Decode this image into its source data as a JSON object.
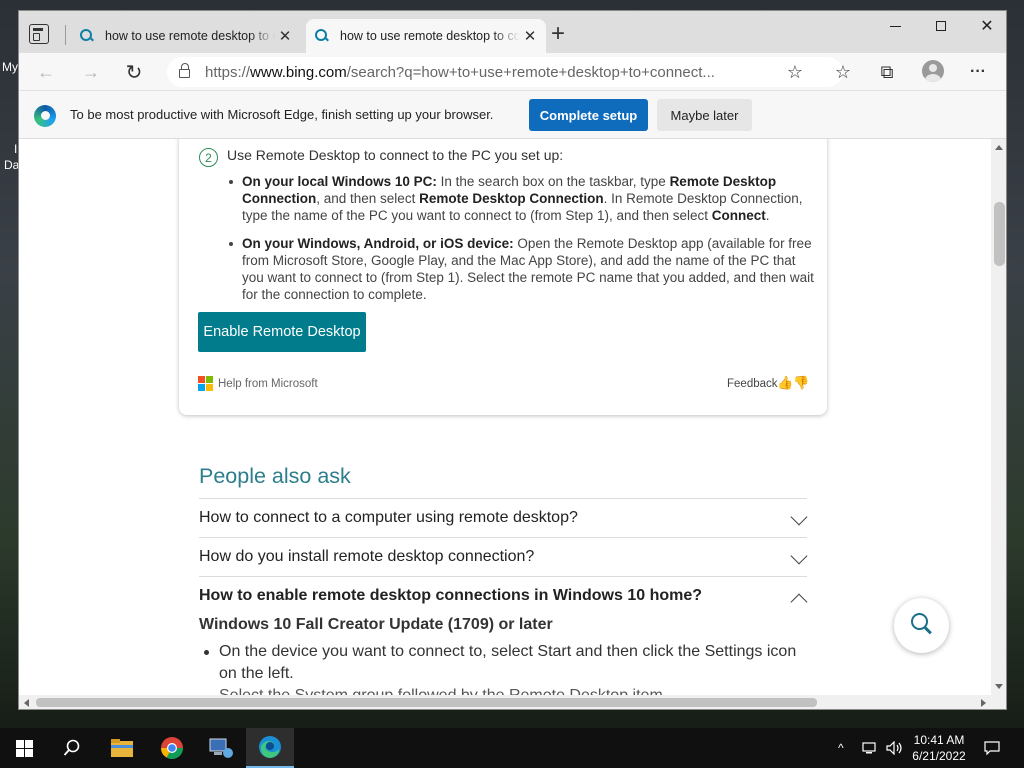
{
  "desktop": {
    "labels": [
      "My",
      "I",
      "Da"
    ]
  },
  "browser": {
    "tabs": [
      {
        "title": "how to use remote desktop to connect to a pc"
      },
      {
        "title": "how to use remote desktop to connect to a pc"
      }
    ],
    "new_tab": "+",
    "address": {
      "scheme": "https://",
      "host": "www.bing.com",
      "path": "/search?q=how+to+use+remote+desktop+to+connect..."
    },
    "icons": {
      "back": "←",
      "forward": "→",
      "refresh": "↻",
      "favorite_add": "☆",
      "favorites": "☆",
      "collections": "⧉",
      "menu": "···"
    }
  },
  "infobar": {
    "message": "To be most productive with Microsoft Edge, finish setting up your browser.",
    "primary_label": "Complete setup",
    "secondary_label": "Maybe later"
  },
  "card": {
    "step_number": "2",
    "step_text": "Use Remote Desktop to connect to the PC you set up:",
    "bullet1": {
      "lead": "On your local Windows 10 PC:",
      "p1": " In the search box on the taskbar, type ",
      "b1": "Remote Desktop Connection",
      "p2": ", and then select ",
      "b2": "Remote Desktop Connection",
      "p3": ". In Remote Desktop Connection, type the name of the PC you want to connect to (from Step 1), and then select ",
      "b3": "Connect",
      "p4": "."
    },
    "bullet2": {
      "lead": "On your Windows, Android, or iOS device:",
      "text": " Open the Remote Desktop app (available for free from Microsoft Store, Google Play, and the Mac App Store), and add the name of the PC that you want to connect to (from Step 1).  Select the remote PC name that you added, and then wait for the connection to complete."
    },
    "button_label": "Enable Remote Desktop",
    "help_text": "Help from Microsoft",
    "feedback_label": "Feedback",
    "thumbs_up": "👍",
    "thumbs_down": "👎"
  },
  "people_also_ask": {
    "title": "People also ask",
    "questions": [
      "How to connect to a computer using remote desktop?",
      "How do you install remote desktop connection?",
      "How to enable remote desktop connections in Windows 10 home?"
    ],
    "answer_heading": "Windows 10 Fall Creator Update (1709) or later",
    "answer_bullet": "On the device you want to connect to, select Start and then click the Settings icon on the left.",
    "answer_bullet_cut": "Select the System group followed by the Remote Desktop item."
  },
  "taskbar": {
    "clock_time": "10:41 AM",
    "clock_date": "6/21/2022",
    "tray_chevron": "^"
  },
  "colors": {
    "accent_blue": "#0f6cbd",
    "teal_button": "#007c8c",
    "paa_title": "#2c7e8d"
  }
}
